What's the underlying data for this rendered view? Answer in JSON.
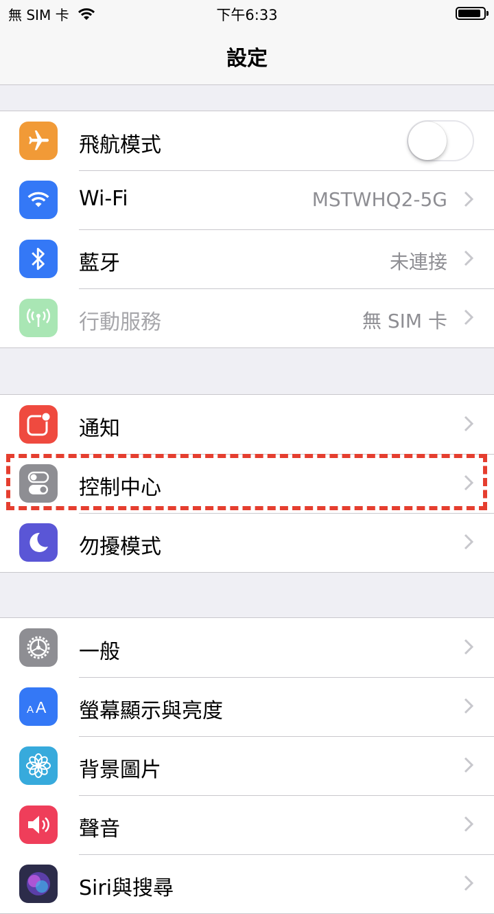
{
  "status_bar": {
    "carrier": "無 SIM 卡",
    "time": "下午6:33",
    "wifi_icon": "wifi-icon",
    "battery_icon": "battery-icon"
  },
  "nav": {
    "title": "設定"
  },
  "groups": [
    {
      "items": [
        {
          "label": "飛航模式",
          "icon": "airplane-icon",
          "icon_color": "#f19a37",
          "toggle": {
            "on": false
          }
        },
        {
          "label": "Wi-Fi",
          "value": "MSTWHQ2-5G",
          "icon": "wifi-icon",
          "icon_color": "#3478f6"
        },
        {
          "label": "藍牙",
          "value": "未連接",
          "icon": "bluetooth-icon",
          "icon_color": "#3478f6"
        },
        {
          "label": "行動服務",
          "value": "無 SIM 卡",
          "icon": "antenna-icon",
          "icon_color": "#a9e6b4",
          "disabled": true
        }
      ]
    },
    {
      "items": [
        {
          "label": "通知",
          "icon": "notifications-icon",
          "icon_color": "#ef4a3f"
        },
        {
          "label": "控制中心",
          "icon": "control-center-icon",
          "icon_color": "#8e8e93",
          "highlighted": true
        },
        {
          "label": "勿擾模式",
          "icon": "moon-icon",
          "icon_color": "#5a56d6"
        }
      ]
    },
    {
      "items": [
        {
          "label": "一般",
          "icon": "gear-icon",
          "icon_color": "#8e8e93"
        },
        {
          "label": "螢幕顯示與亮度",
          "icon": "display-brightness-icon",
          "icon_color": "#3478f6"
        },
        {
          "label": "背景圖片",
          "icon": "wallpaper-icon",
          "icon_color": "#37aadc"
        },
        {
          "label": "聲音",
          "icon": "sound-icon",
          "icon_color": "#ef3e5a"
        },
        {
          "label": "Siri與搜尋",
          "icon": "siri-icon",
          "icon_color": "#2c2c4a"
        }
      ]
    }
  ],
  "annotation": {
    "highlight_color": "#e53e2f"
  }
}
